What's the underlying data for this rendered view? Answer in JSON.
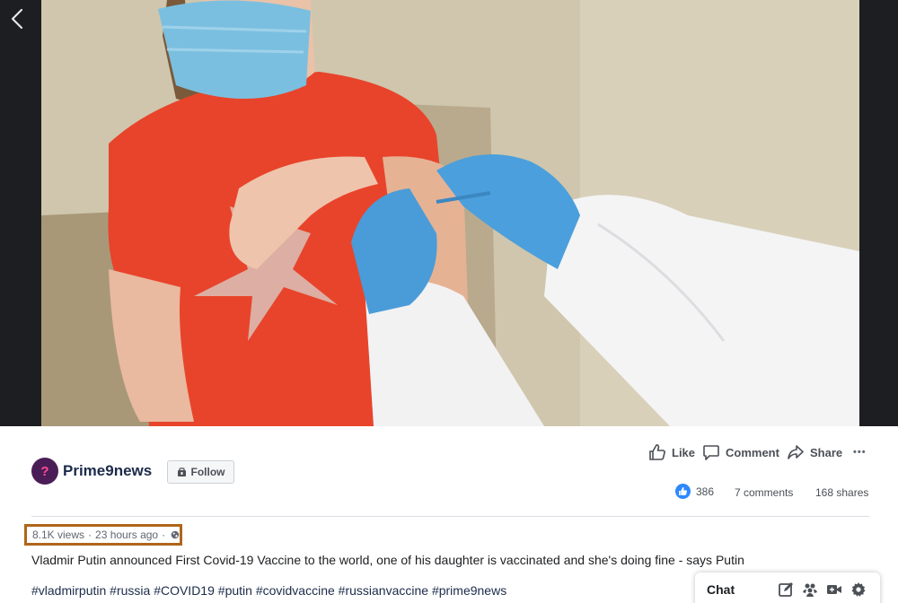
{
  "page": {
    "name": "Prime9news",
    "avatar_glyph": "?",
    "follow_label": "Follow"
  },
  "actions": {
    "like_label": "Like",
    "comment_label": "Comment",
    "share_label": "Share",
    "more_label": "•••"
  },
  "stats": {
    "reactions_count": "386",
    "comments": "7 comments",
    "shares": "168 shares"
  },
  "post": {
    "views": "8.1K views",
    "separator": "·",
    "time": "23 hours ago",
    "audience_icon": "globe-icon",
    "description": "Vladmir Putin announced First Covid-19 Vaccine to the world, one of his daughter is vaccinated and she's doing fine - says Putin",
    "hashtags": [
      "#vladmirputin",
      "#russia",
      "#COVID19",
      "#putin",
      "#covidvaccine",
      "#russianvaccine",
      "#prime9news"
    ]
  },
  "chat": {
    "label": "Chat",
    "icons": [
      "new-message-icon",
      "group-icon",
      "video-call-icon",
      "settings-gear-icon"
    ]
  },
  "colors": {
    "highlight_box": "#b0651a",
    "like_blue": "#2d88ff",
    "link_navy": "#1c2b4a",
    "video_background": "#1c1e21"
  }
}
